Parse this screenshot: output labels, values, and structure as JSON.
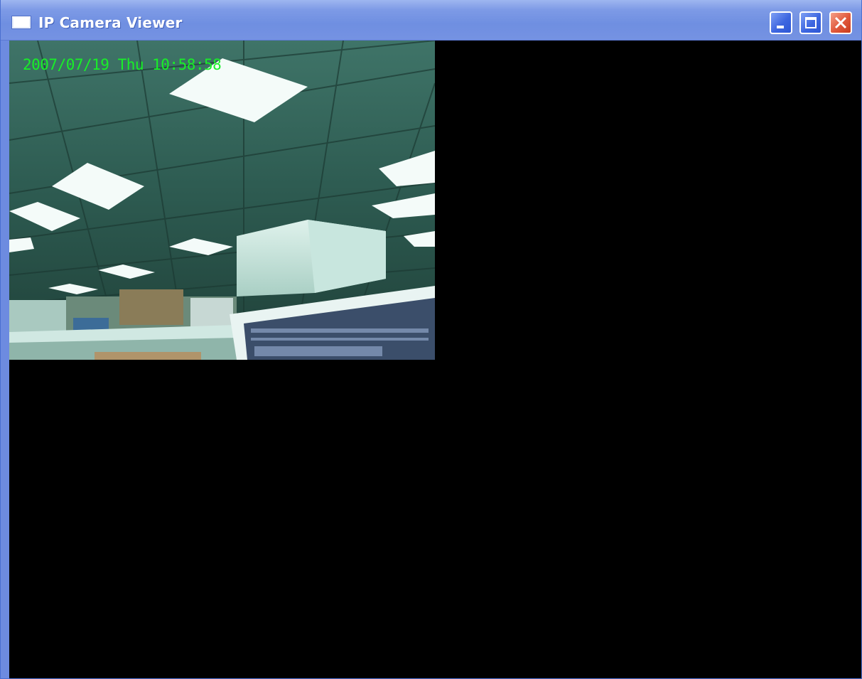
{
  "window": {
    "title": "IP Camera Viewer",
    "icon": "window-app-icon",
    "controls": [
      "minimize-icon",
      "maximize-icon",
      "close-icon"
    ],
    "colors": {
      "titlebar": "#7592e2",
      "close_button": "#e0573a",
      "background": "#000000"
    }
  },
  "camera": {
    "timestamp": "2007/07/19 Thu 10:58:58",
    "overlay_color": "#18f028"
  }
}
